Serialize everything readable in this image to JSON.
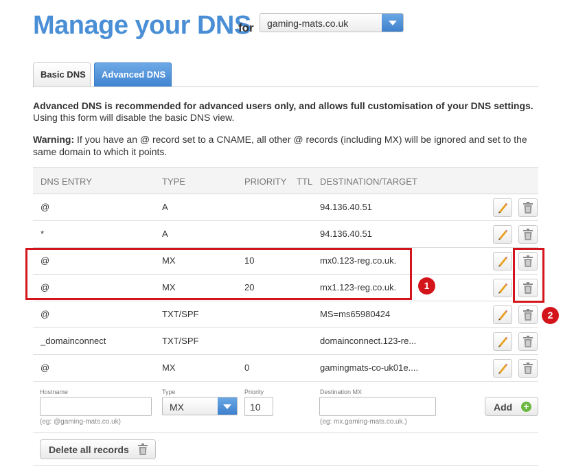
{
  "header": {
    "title": "Manage your DNS",
    "for_label": "for",
    "domain_selected": "gaming-mats.co.uk"
  },
  "tabs": [
    {
      "label": "Basic DNS",
      "active": false
    },
    {
      "label": "Advanced DNS",
      "active": true
    }
  ],
  "intro": {
    "line1": "Advanced DNS is recommended for advanced users only, and allows full customisation of your DNS settings.",
    "line2": "Using this form will disable the basic DNS view."
  },
  "warning": {
    "label": "Warning:",
    "text": " If you have an @ record set to a CNAME, all other @ records (including MX) will be ignored and set to the same domain to which it points."
  },
  "table": {
    "headers": {
      "entry": "DNS ENTRY",
      "type": "TYPE",
      "priority": "PRIORITY",
      "ttl": "TTL",
      "destination": "DESTINATION/TARGET"
    },
    "rows": [
      {
        "entry": "@",
        "type": "A",
        "priority": "",
        "ttl": "",
        "destination": "94.136.40.51"
      },
      {
        "entry": "*",
        "type": "A",
        "priority": "",
        "ttl": "",
        "destination": "94.136.40.51"
      },
      {
        "entry": "@",
        "type": "MX",
        "priority": "10",
        "ttl": "",
        "destination": "mx0.123-reg.co.uk."
      },
      {
        "entry": "@",
        "type": "MX",
        "priority": "20",
        "ttl": "",
        "destination": "mx1.123-reg.co.uk."
      },
      {
        "entry": "@",
        "type": "TXT/SPF",
        "priority": "",
        "ttl": "",
        "destination": "MS=ms65980424"
      },
      {
        "entry": "_domainconnect",
        "type": "TXT/SPF",
        "priority": "",
        "ttl": "",
        "destination": "domainconnect.123-re..."
      },
      {
        "entry": "@",
        "type": "MX",
        "priority": "0",
        "ttl": "",
        "destination": "gamingmats-co-uk01e...."
      }
    ]
  },
  "add_form": {
    "hostname_label": "Hostname",
    "hostname_value": "",
    "hostname_hint": "(eg: @gaming-mats.co.uk)",
    "type_label": "Type",
    "type_value": "MX",
    "priority_label": "Priority",
    "priority_value": "10",
    "destination_label": "Destination MX",
    "destination_value": "",
    "destination_hint": "(eg: mx.gaming-mats.co.uk.)",
    "add_label": "Add"
  },
  "delete_all_label": "Delete all records",
  "annotations": {
    "badge1": "1",
    "badge2": "2"
  },
  "colors": {
    "brand_blue": "#4a8fd6",
    "highlight_red": "#d4141b",
    "add_green": "#6ab83f"
  }
}
